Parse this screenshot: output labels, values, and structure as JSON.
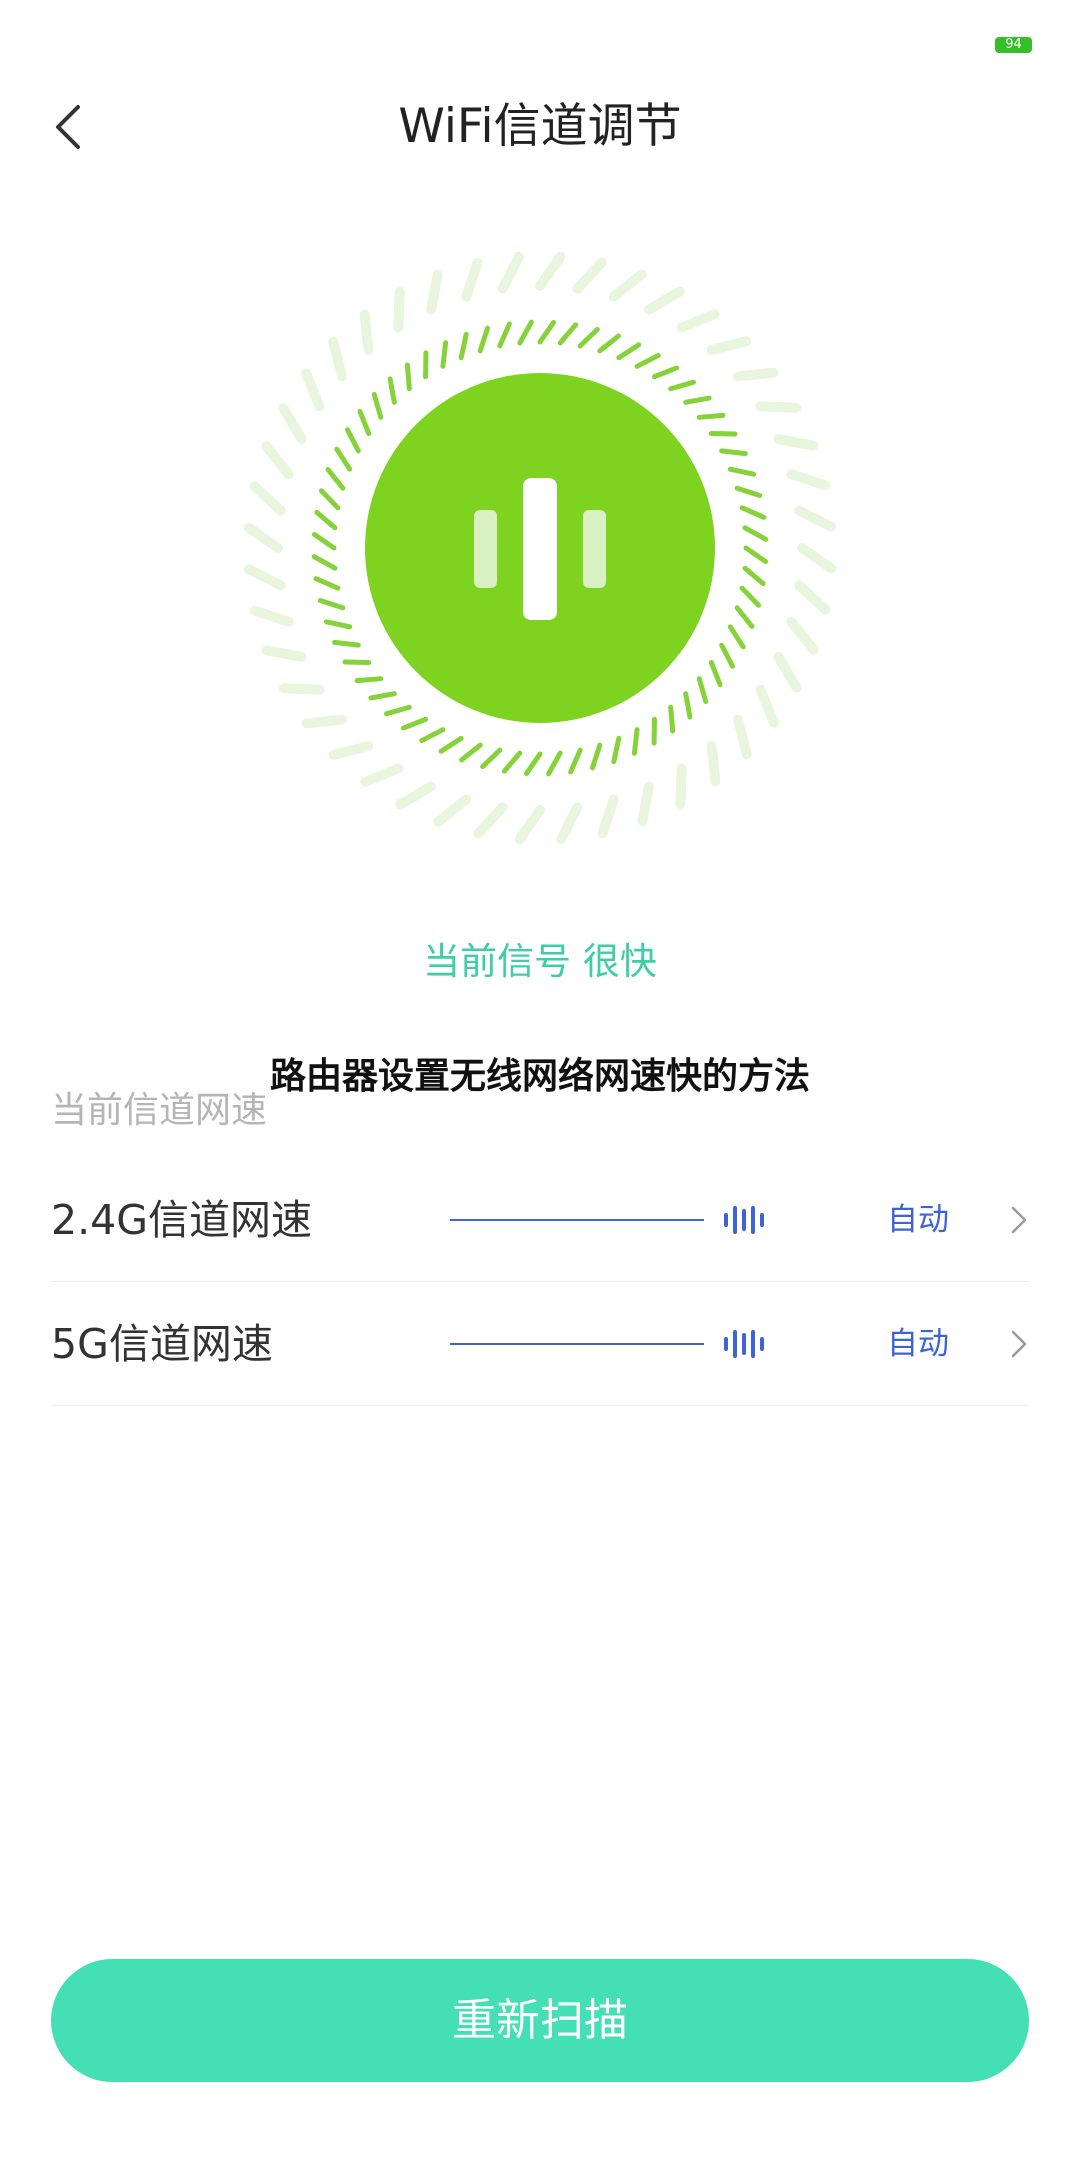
{
  "status_bar": {
    "battery_level": "94",
    "battery_icon": "battery-icon"
  },
  "header": {
    "title": "WiFi信道调节",
    "back_icon": "chevron-left-icon"
  },
  "signal": {
    "status_label": "当前信号 很快",
    "icon": "signal-bars-icon"
  },
  "overlay_caption": "路由器设置无线网络网速快的方法",
  "channels": {
    "section_label": "当前信道网速",
    "rows": [
      {
        "name": "2.4G信道网速",
        "mode": "自动",
        "icon": "sound-wave-icon"
      },
      {
        "name": "5G信道网速",
        "mode": "自动",
        "icon": "sound-wave-icon"
      }
    ]
  },
  "actions": {
    "rescan_label": "重新扫描"
  },
  "colors": {
    "green": "#7ed321",
    "teal": "#3dcfa3",
    "blue": "#3f63d6",
    "button": "#44dfb5",
    "battery": "#35c02a"
  }
}
